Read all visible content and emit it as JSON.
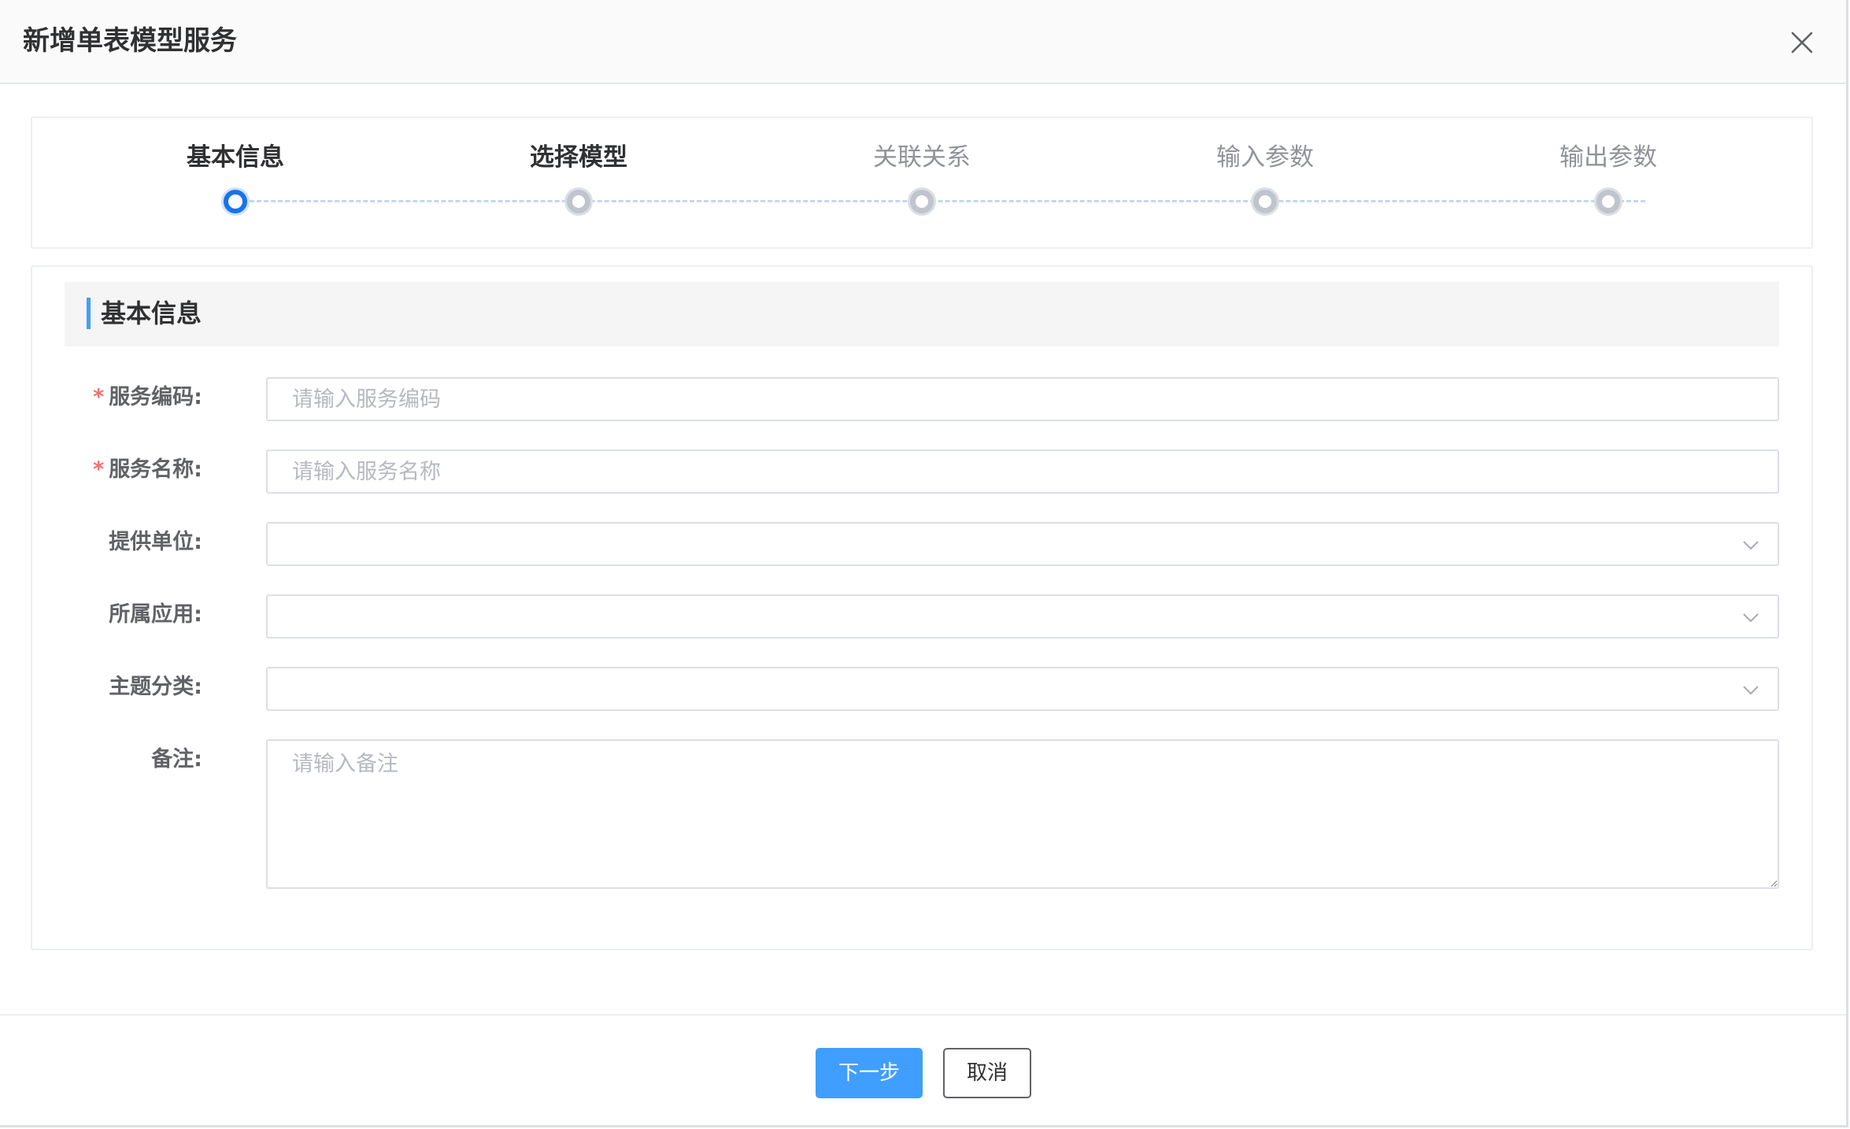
{
  "dialog": {
    "title": "新增单表模型服务",
    "close_icon": "close-icon"
  },
  "steps": [
    {
      "label": "基本信息",
      "state": "active"
    },
    {
      "label": "选择模型",
      "state": "next"
    },
    {
      "label": "关联关系",
      "state": "pending"
    },
    {
      "label": "输入参数",
      "state": "pending"
    },
    {
      "label": "输出参数",
      "state": "pending"
    }
  ],
  "section": {
    "title": "基本信息"
  },
  "form": {
    "required_mark": "*",
    "service_code": {
      "label": "服务编码:",
      "placeholder": "请输入服务编码",
      "value": ""
    },
    "service_name": {
      "label": "服务名称:",
      "placeholder": "请输入服务名称",
      "value": ""
    },
    "provider_unit": {
      "label": "提供单位:",
      "value": ""
    },
    "belong_app": {
      "label": "所属应用:",
      "value": ""
    },
    "topic_category": {
      "label": "主题分类:",
      "value": ""
    },
    "remark": {
      "label": "备注:",
      "placeholder": "请输入备注",
      "value": ""
    }
  },
  "footer": {
    "next_label": "下一步",
    "cancel_label": "取消"
  },
  "colors": {
    "primary": "#409eff",
    "required": "#f56c6c",
    "active_step": "#1a73e8"
  }
}
